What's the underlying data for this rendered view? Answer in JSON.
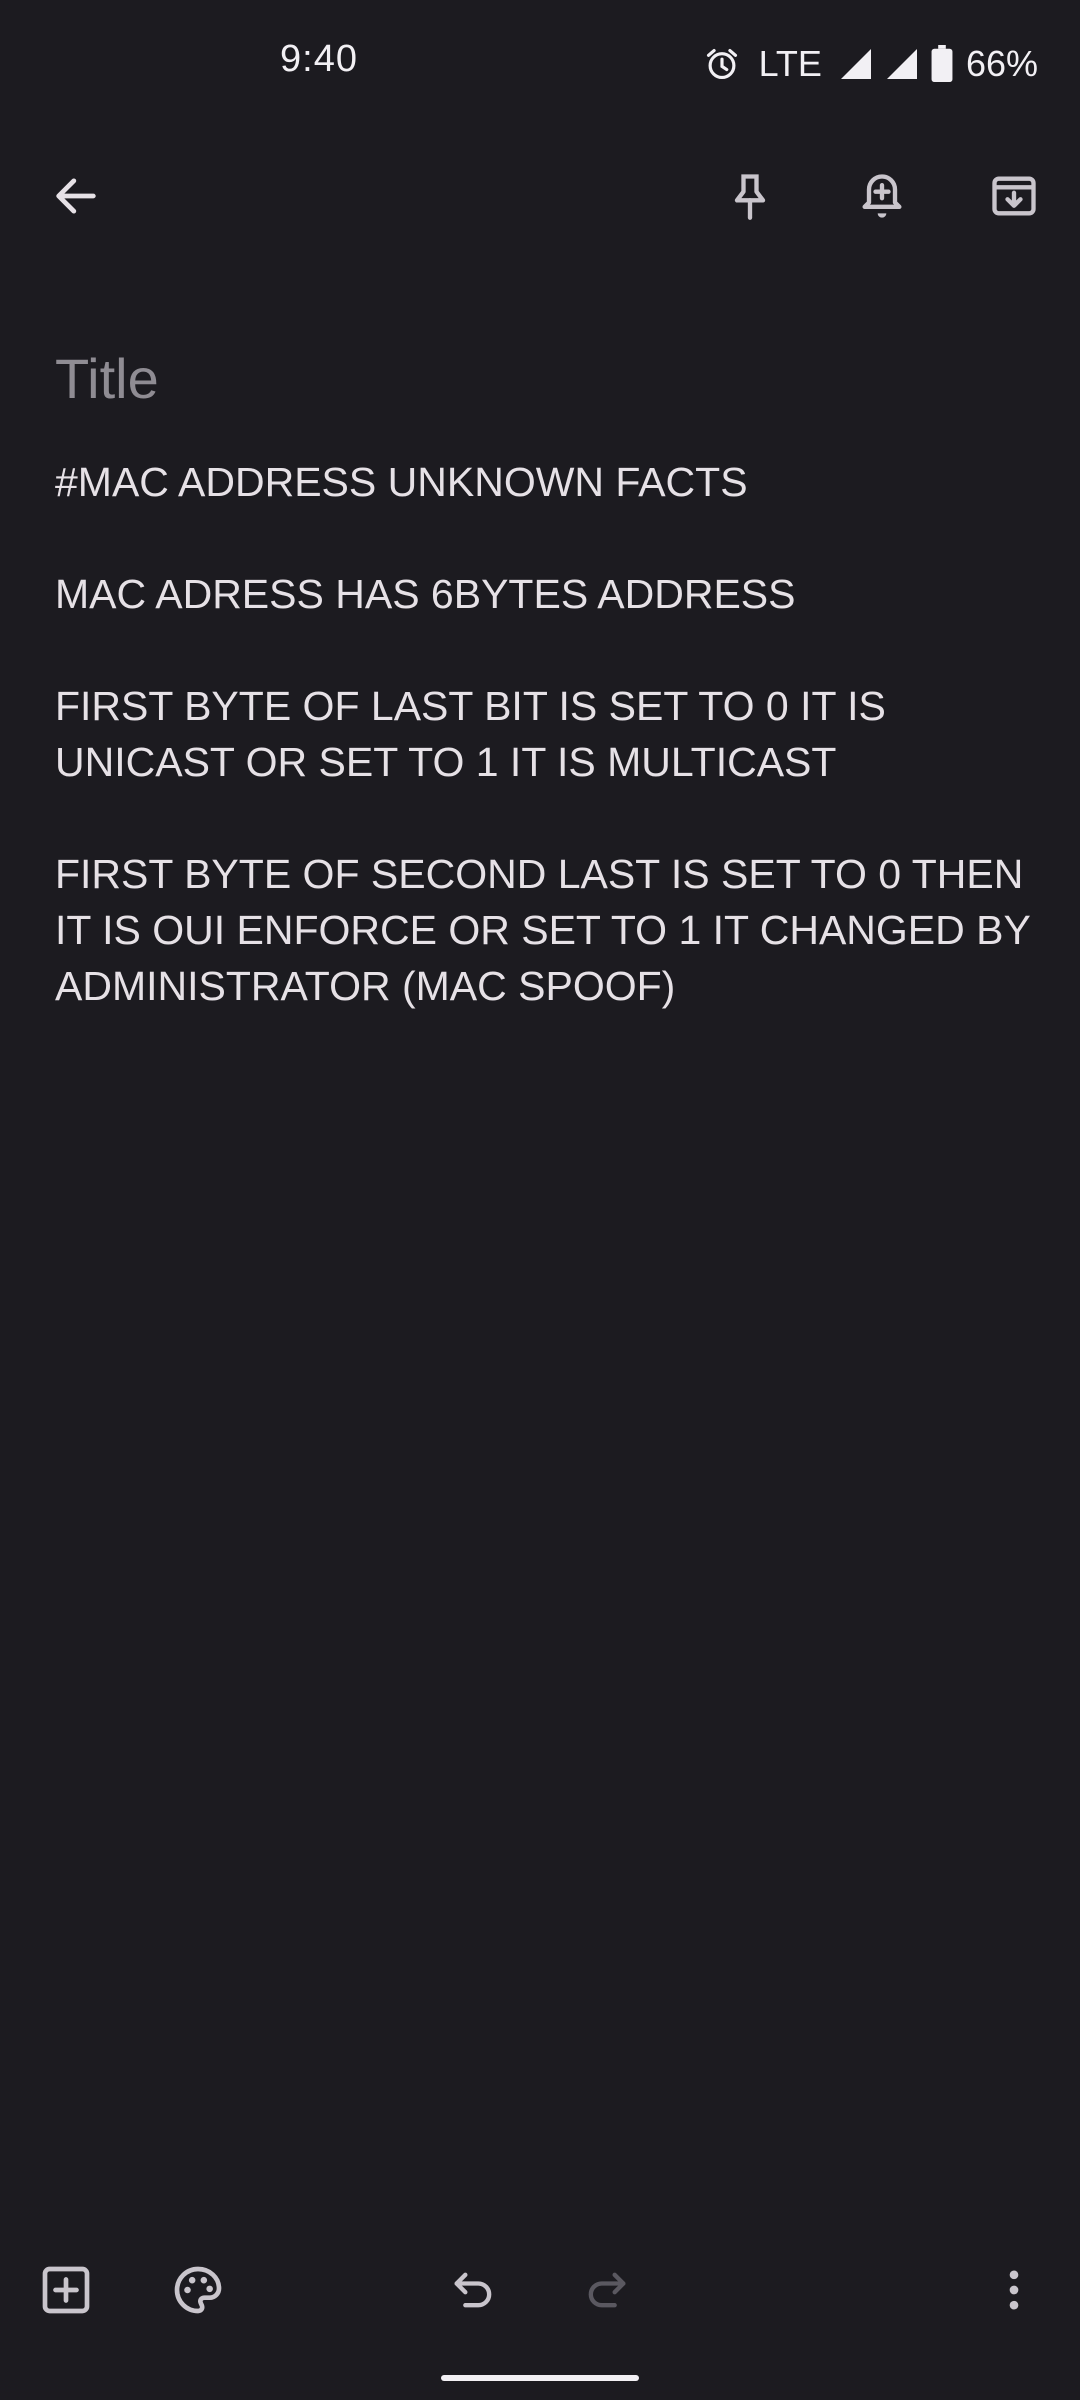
{
  "status_bar": {
    "time": "9:40",
    "network": "LTE",
    "battery": "66%",
    "icons": [
      "alarm-icon",
      "signal-icon",
      "signal-icon",
      "battery-icon"
    ]
  },
  "toolbar": {
    "back_icon": "arrow-back-icon",
    "pin_icon": "pin-icon",
    "reminder_icon": "add-alert-icon",
    "archive_icon": "archive-icon"
  },
  "note": {
    "title_placeholder": "Title",
    "paragraphs": [
      "#MAC ADDRESS UNKNOWN FACTS",
      "MAC ADRESS HAS 6BYTES ADDRESS",
      "FIRST BYTE OF LAST BIT IS SET TO 0 IT IS UNICAST OR SET TO 1 IT IS MULTICAST",
      "FIRST BYTE OF SECOND LAST IS SET TO 0 THEN IT IS OUI ENFORCE OR SET TO 1 IT CHANGED BY ADMINISTRATOR (MAC SPOOF)"
    ]
  },
  "bottom_bar": {
    "add_icon": "add-box-icon",
    "palette_icon": "palette-icon",
    "undo_icon": "undo-icon",
    "redo_icon": "redo-icon",
    "more_icon": "more-vert-icon"
  },
  "colors": {
    "background": "#1c1b20",
    "text": "#e6e1e6",
    "placeholder": "#8f8c93",
    "icon": "#c9c5cc",
    "disabled_icon": "#5a5860"
  }
}
